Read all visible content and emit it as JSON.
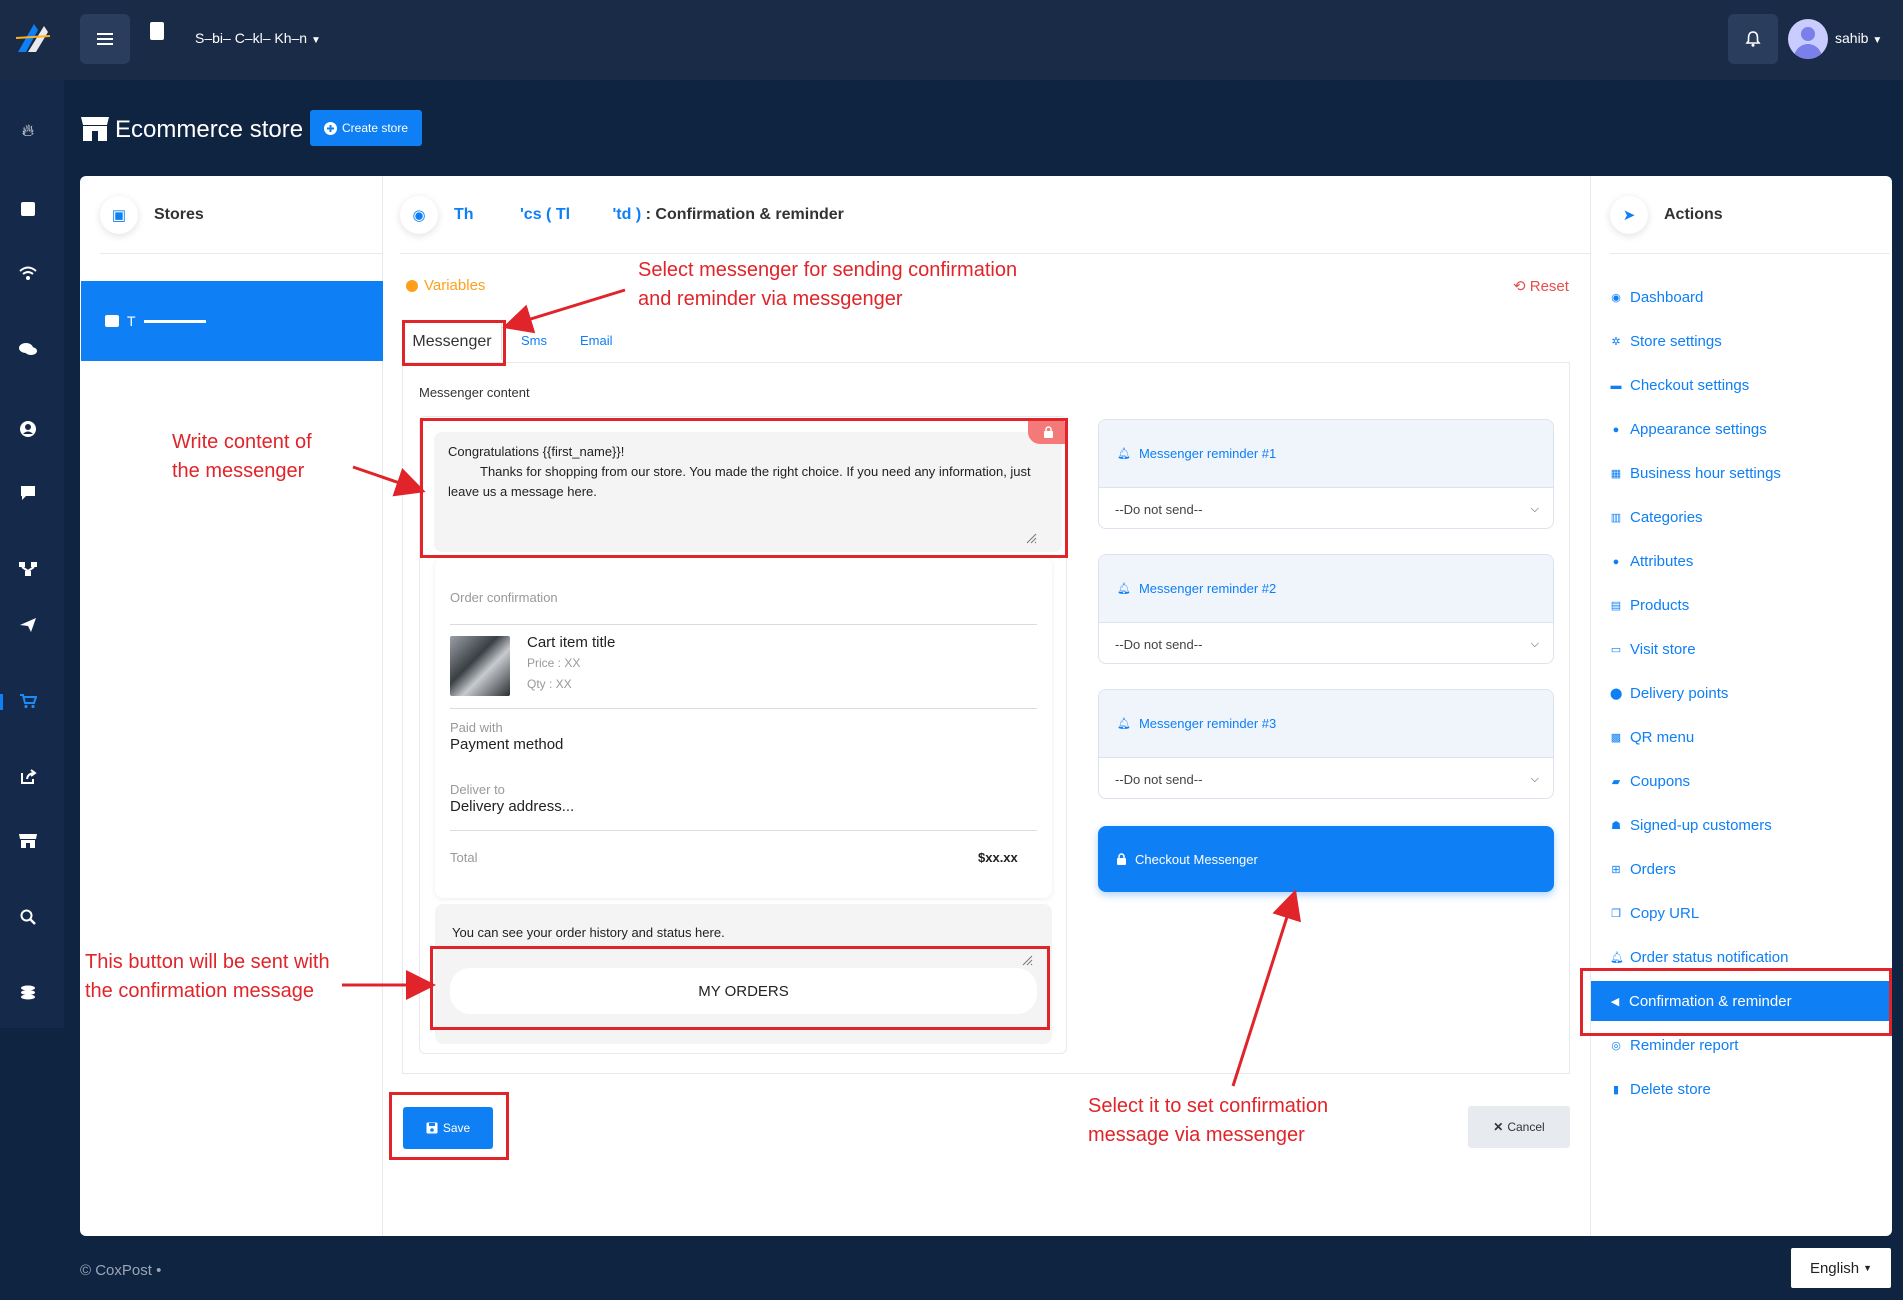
{
  "header": {
    "account_name": "S–bi– C–kl– Kh–n",
    "user_name": "sahib"
  },
  "page": {
    "title": "Ecommerce store",
    "create_store_label": "Create store"
  },
  "stores": {
    "title": "Stores",
    "selected_store": "T"
  },
  "editor": {
    "heading_prefix": "Th",
    "heading_suffix": "'cs ( Tl",
    "heading_suffix2": "'td )",
    "heading_title": ": Confirmation & reminder",
    "variables_label": "Variables",
    "reset_label": "Reset",
    "tabs": [
      "Messenger",
      "Sms",
      "Email"
    ],
    "content_label": "Messenger content",
    "message_line1": "Congratulations {{first_name}}!",
    "message_line2": "Thanks for shopping from our store. You made the right choice. If you need any information, just leave us a message here.",
    "order": {
      "section_title": "Order confirmation",
      "item_title": "Cart item title",
      "price": "Price : XX",
      "qty": "Qty : XX",
      "paid_with_label": "Paid with",
      "paid_with_value": "Payment method",
      "deliver_to_label": "Deliver to",
      "deliver_to_value": "Delivery address...",
      "total_label": "Total",
      "total_value": "$xx.xx"
    },
    "history_text": "You can see your order history and status here.",
    "my_orders_label": "MY ORDERS",
    "reminders": [
      {
        "label": "Messenger reminder #1",
        "value": "--Do not send--"
      },
      {
        "label": "Messenger reminder #2",
        "value": "--Do not send--"
      },
      {
        "label": "Messenger reminder #3",
        "value": "--Do not send--"
      }
    ],
    "checkout_label": "Checkout Messenger",
    "save_label": "Save",
    "cancel_label": "Cancel"
  },
  "actions": {
    "title": "Actions",
    "items": [
      "Dashboard",
      "Store settings",
      "Checkout settings",
      "Appearance settings",
      "Business hour settings",
      "Categories",
      "Attributes",
      "Products",
      "Visit store",
      "Delivery points",
      "QR menu",
      "Coupons",
      "Signed-up customers",
      "Orders",
      "Copy URL",
      "Order status notification",
      "Confirmation & reminder",
      "Reminder report",
      "Delete store"
    ]
  },
  "annotations": {
    "select_messenger": "Select messenger for sending confirmation\nand reminder via messgenger",
    "write_content": "Write content of\nthe messenger",
    "button_sent": "This button will be sent with\nthe confirmation message",
    "select_checkout": "Select it to set confirmation\nmessage via messenger"
  },
  "footer": {
    "copyright": "© CoxPost •",
    "language": "English"
  },
  "colors": {
    "primary": "#0e7ff5",
    "annotation_red": "#e0242a",
    "topbar": "#1a2b47",
    "background": "#0f2440"
  }
}
